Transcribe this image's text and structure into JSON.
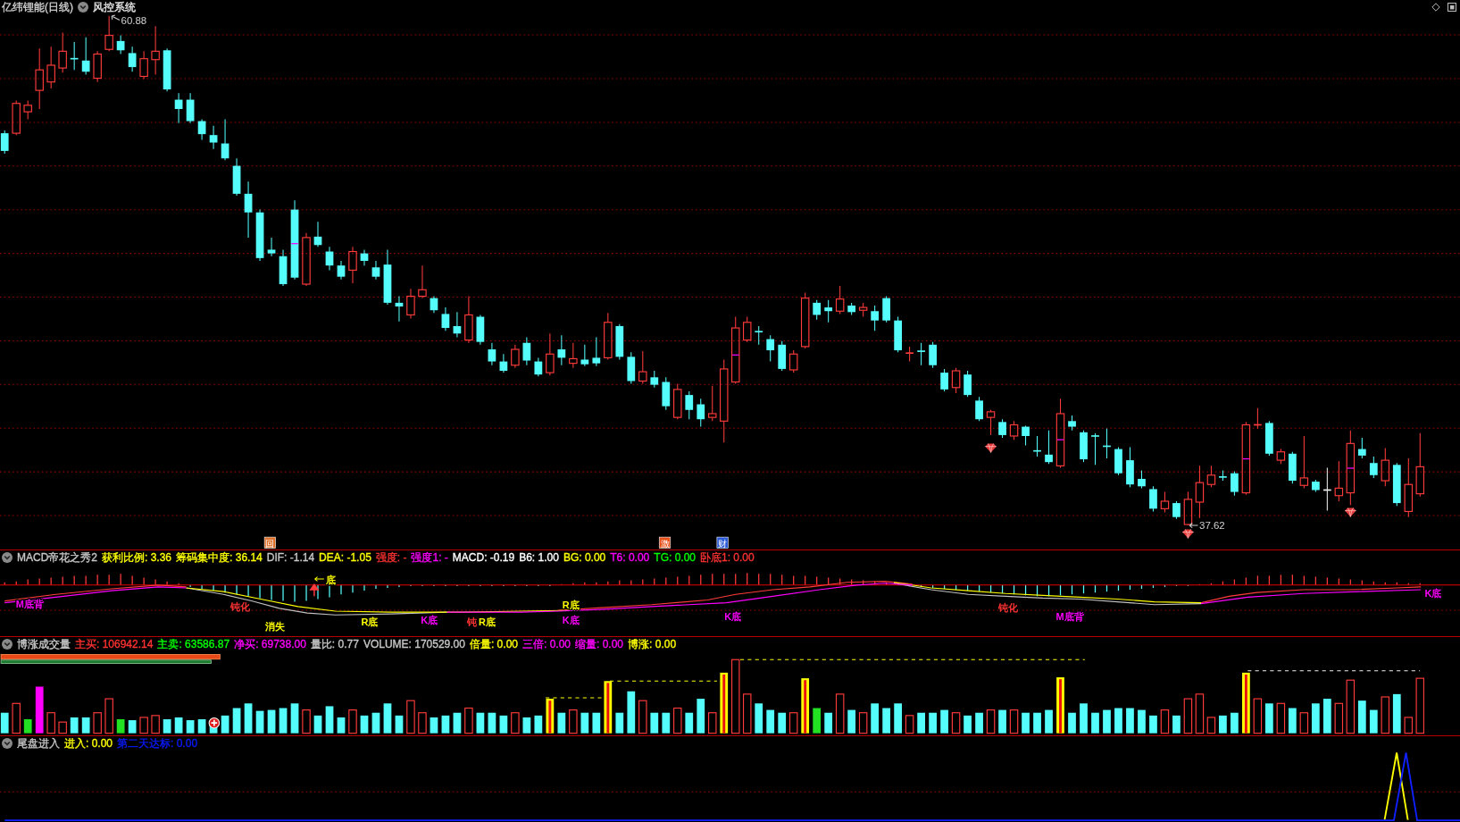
{
  "main_chart": {
    "title": "亿纬锂能(日线)",
    "indicator": "风控系统",
    "high_label": "60.88",
    "low_label": "37.62",
    "event_tags": [
      {
        "text": "回",
        "color": "#e0702a"
      },
      {
        "text": "激",
        "color": "#e8501a"
      },
      {
        "text": "财",
        "color": "#2a5ad8"
      }
    ]
  },
  "macd_panel": {
    "name": "MACD帝花之秀2",
    "readouts": [
      {
        "text": "获利比例: 3.36",
        "color": "#ffff00"
      },
      {
        "text": "筹码集中度: 36.14",
        "color": "#ffff00"
      },
      {
        "text": "DIF: -1.14",
        "color": "#c8c8c8"
      },
      {
        "text": "DEA: -1.05",
        "color": "#ffff00"
      },
      {
        "text": "强度: -",
        "color": "#ff3232"
      },
      {
        "text": "强度1: -",
        "color": "#ff00ff"
      },
      {
        "text": "MACD: -0.19",
        "color": "#ffffff"
      },
      {
        "text": "B6: 1.00",
        "color": "#ffffff"
      },
      {
        "text": "BG: 0.00",
        "color": "#ffff00"
      },
      {
        "text": "T6: 0.00",
        "color": "#ff00ff"
      },
      {
        "text": "TG: 0.00",
        "color": "#00ff00"
      },
      {
        "text": "卧底1: 0.00",
        "color": "#ff3232"
      }
    ],
    "signals": [
      {
        "text": "M底背",
        "color": "#ff00ff"
      },
      {
        "text": "钝化",
        "color": "#ff3232"
      },
      {
        "text": "消失",
        "color": "#ffff00"
      },
      {
        "text": "底",
        "color": "#ffff00"
      },
      {
        "text": "R底",
        "color": "#ffff00"
      },
      {
        "text": "K底",
        "color": "#ff00ff"
      },
      {
        "text": "钝",
        "color": "#ff3232"
      },
      {
        "text": "R底",
        "color": "#ffff00"
      },
      {
        "text": "R底",
        "color": "#ffff00"
      },
      {
        "text": "K底",
        "color": "#ff00ff"
      },
      {
        "text": "K底",
        "color": "#ff00ff"
      },
      {
        "text": "钝化",
        "color": "#ff3232"
      },
      {
        "text": "M底背",
        "color": "#ff00ff"
      },
      {
        "text": "K底",
        "color": "#ff00ff"
      }
    ]
  },
  "volume_panel": {
    "name": "博涨成交量",
    "readouts": [
      {
        "text": "主买: 106942.14",
        "color": "#ff3232"
      },
      {
        "text": "主卖: 63586.87",
        "color": "#00ff00"
      },
      {
        "text": "净买: 69738.00",
        "color": "#ff00ff"
      },
      {
        "text": "量比: 0.77",
        "color": "#c8c8c8"
      },
      {
        "text": "VOLUME: 170529.00",
        "color": "#c8c8c8"
      },
      {
        "text": "倍量: 0.00",
        "color": "#ffff00"
      },
      {
        "text": "三倍: 0.00",
        "color": "#ff00ff"
      },
      {
        "text": "缩量: 0.00",
        "color": "#ff00ff"
      },
      {
        "text": "博涨: 0.00",
        "color": "#ffff00"
      }
    ],
    "ratio_bars": [
      {
        "kind": "buy",
        "level": 0.15
      },
      {
        "kind": "sell",
        "level": 0.144
      }
    ]
  },
  "entry_panel": {
    "name": "尾盘进入",
    "readouts": [
      {
        "text": "进入: 0.00",
        "color": "#ffff00"
      },
      {
        "text": "第二天达标: 0.00",
        "color": "#0a1aff"
      }
    ]
  }
}
